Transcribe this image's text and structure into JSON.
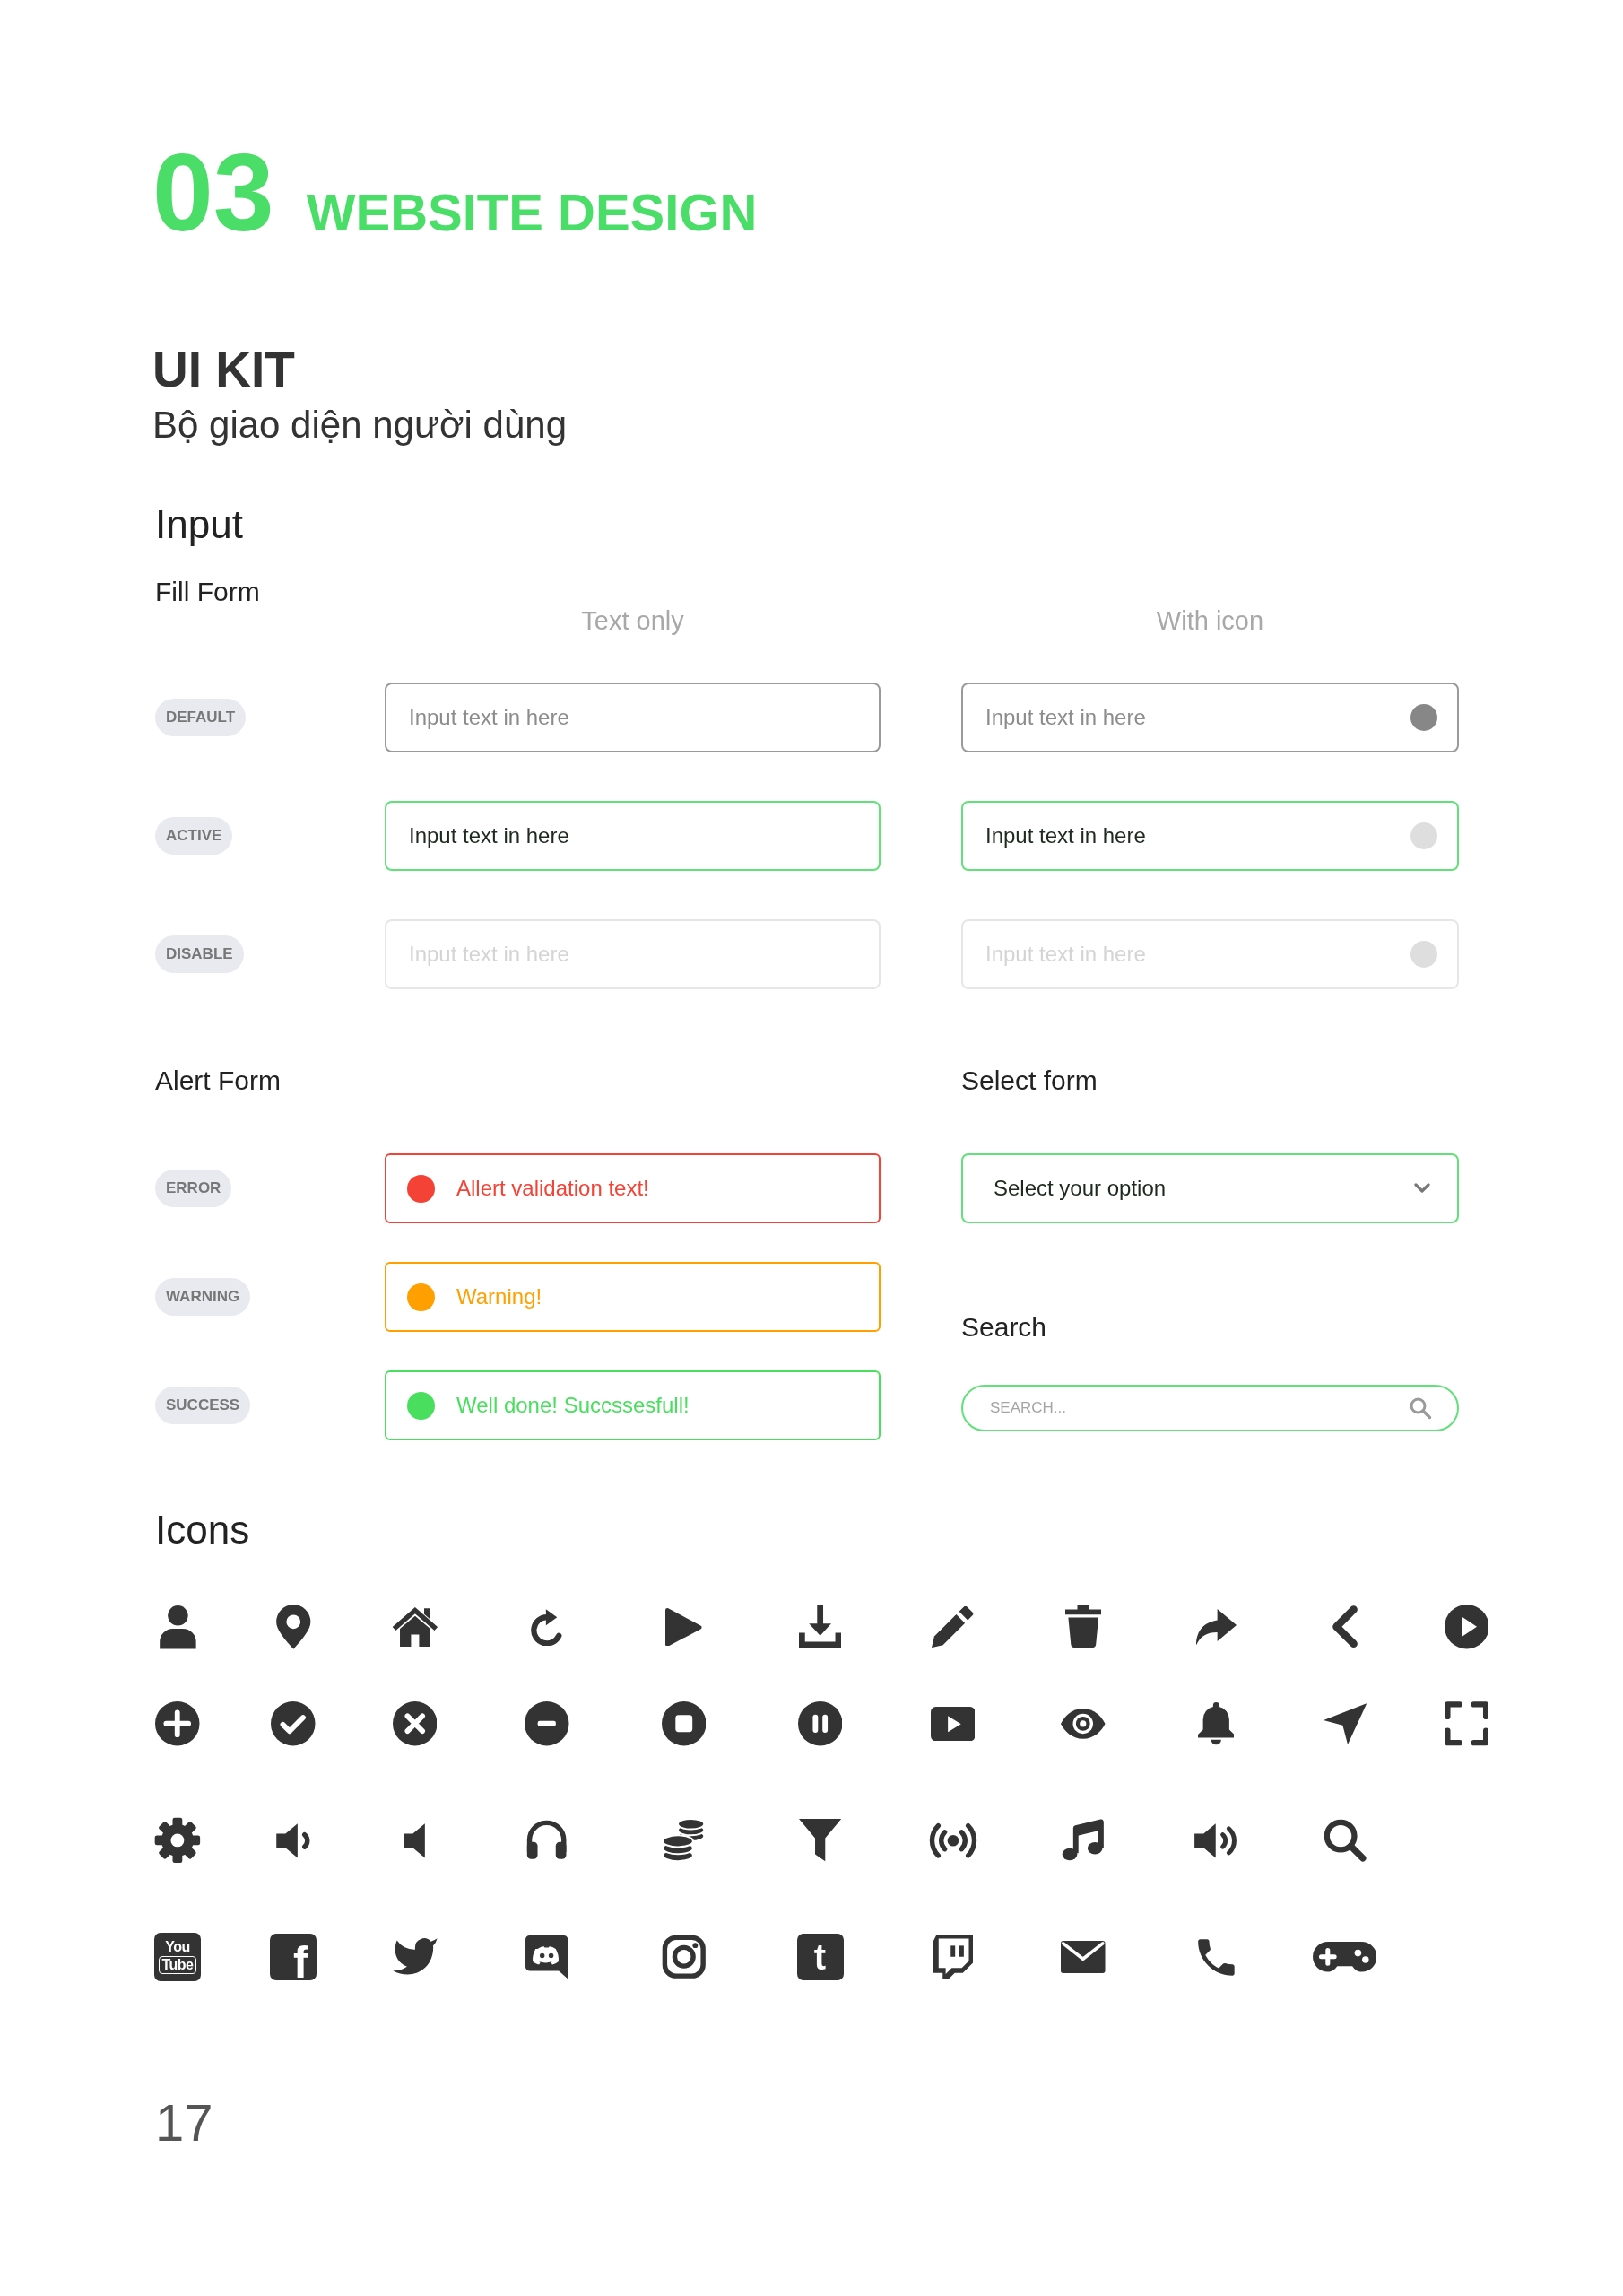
{
  "header": {
    "number": "03",
    "title": "WEBSITE DESIGN"
  },
  "kit": {
    "title": "UI KIT",
    "subtitle": "Bộ giao diện người dùng"
  },
  "input": {
    "title": "Input",
    "fill_form": {
      "title": "Fill Form",
      "columns": [
        "Text only",
        "With icon"
      ],
      "rows": [
        {
          "label": "DEFAULT",
          "fields": [
            {
              "kind": "text",
              "placeholder": "Input text in here",
              "active": false,
              "disabled": false
            },
            {
              "kind": "with_icon",
              "placeholder": "Input text in here",
              "active": false,
              "disabled": false
            }
          ]
        },
        {
          "label": "ACTIVE",
          "fields": [
            {
              "kind": "text",
              "value": "Input text in here",
              "active": true,
              "disabled": false
            },
            {
              "kind": "with_icon",
              "value": "Input text in here",
              "active": true,
              "disabled": false
            }
          ]
        },
        {
          "label": "DISABLE",
          "fields": [
            {
              "kind": "text",
              "placeholder": "Input text in here",
              "active": false,
              "disabled": true
            },
            {
              "kind": "with_icon",
              "placeholder": "Input text in here",
              "active": false,
              "disabled": true
            }
          ]
        }
      ]
    },
    "alert_form": {
      "title": "Alert Form",
      "alerts": [
        {
          "label": "ERROR",
          "text": "Allert validation text!",
          "color": "#f44336"
        },
        {
          "label": "WARNING",
          "text": "Warning!",
          "color": "#ffa000"
        },
        {
          "label": "SUCCESS",
          "text": "Well done! Succssesfull!",
          "color": "#4ade5f"
        }
      ]
    },
    "select_form": {
      "title": "Select form",
      "value": "Select your option"
    },
    "search": {
      "title": "Search",
      "placeholder": "SEARCH..."
    }
  },
  "icons": {
    "title": "Icons",
    "logo_tiles": [
      {
        "kind": "stacked",
        "lines": [
          "You",
          "Tube"
        ]
      },
      {
        "kind": "corner",
        "text": "f"
      },
      {
        "kind": "centered",
        "text": "t"
      }
    ]
  },
  "page_number": "17"
}
